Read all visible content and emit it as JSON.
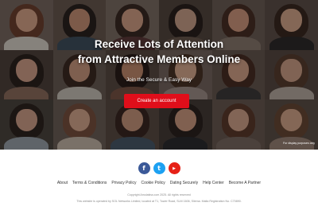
{
  "hero": {
    "headline_line1": "Receive Lots of Attention",
    "headline_line2": "from Attractive Members Online",
    "subline": "Join the Secure & Easy Way",
    "cta_label": "Create an account",
    "disclaimer": "For display purposes only",
    "tiles": [
      {
        "skin": "#d8a58a",
        "hair": "#6e4230",
        "shirt": "#d9d2c9",
        "bg": "#7a6a62"
      },
      {
        "skin": "#c99277",
        "hair": "#2b2220",
        "shirt": "#3f4f5e",
        "bg": "#6a5a50"
      },
      {
        "skin": "#d4a187",
        "hair": "#3a2a24",
        "shirt": "#5e3a3a",
        "bg": "#7d6e64"
      },
      {
        "skin": "#caa08a",
        "hair": "#2a211e",
        "shirt": "#6b5a4e",
        "bg": "#54473f"
      },
      {
        "skin": "#d0987e",
        "hair": "#4a3026",
        "shirt": "#8a7a6e",
        "bg": "#6c5e56"
      },
      {
        "skin": "#d6a68c",
        "hair": "#3b2921",
        "shirt": "#2e2a2a",
        "bg": "#5e504a"
      },
      {
        "skin": "#d2a089",
        "hair": "#2d221e",
        "shirt": "#8e6e5e",
        "bg": "#4f433d"
      },
      {
        "skin": "#cc9a80",
        "hair": "#3c2a22",
        "shirt": "#c9c2b8",
        "bg": "#6a5c54"
      },
      {
        "skin": "#c48c6e",
        "hair": "#2a1e1a",
        "shirt": "#7a5446",
        "bg": "#5a4b43"
      },
      {
        "skin": "#d9aa8e",
        "hair": "#4b3428",
        "shirt": "#a0908a",
        "bg": "#776760"
      },
      {
        "skin": "#d5a48a",
        "hair": "#4a2e24",
        "shirt": "#3e3a3a",
        "bg": "#675850"
      },
      {
        "skin": "#cfa088",
        "hair": "#5a3e30",
        "shirt": "#b8aca2",
        "bg": "#574a43"
      },
      {
        "skin": "#d1a08a",
        "hair": "#2e2420",
        "shirt": "#9aa2aa",
        "bg": "#4d4640"
      },
      {
        "skin": "#d7a98f",
        "hair": "#7a5240",
        "shirt": "#c5b7a8",
        "bg": "#6d5f57"
      },
      {
        "skin": "#c9967c",
        "hair": "#3a2822",
        "shirt": "#4a5a6a",
        "bg": "#5b4d45"
      },
      {
        "skin": "#cf9c82",
        "hair": "#2c2220",
        "shirt": "#2c2c30",
        "bg": "#463d38"
      },
      {
        "skin": "#d2a48c",
        "hair": "#5c3a2c",
        "shirt": "#7a6a62",
        "bg": "#6a5a52"
      },
      {
        "skin": "#d6a78b",
        "hair": "#6a4a36",
        "shirt": "#9a8476",
        "bg": "#5d4f48"
      }
    ]
  },
  "social": [
    {
      "name": "facebook-icon",
      "glyph": "f",
      "color": "#3b5998"
    },
    {
      "name": "twitter-icon",
      "glyph": "t",
      "color": "#1da1f2"
    },
    {
      "name": "youtube-icon",
      "glyph": "▶",
      "color": "#e62117"
    }
  ],
  "footer": {
    "links": [
      "About",
      "Terms & Conditions",
      "Privacy Policy",
      "Cookie Policy",
      "Dating Securely",
      "Help Center",
      "Become A Partner"
    ],
    "copyright": "Copyright Amolatina.com 2025. All rights reserved",
    "operated_by": "This website is operated by SOL Networks Limited, located at T1, Tower Road, SLM 1606, Sliema. Malta Registration No. C70890."
  }
}
